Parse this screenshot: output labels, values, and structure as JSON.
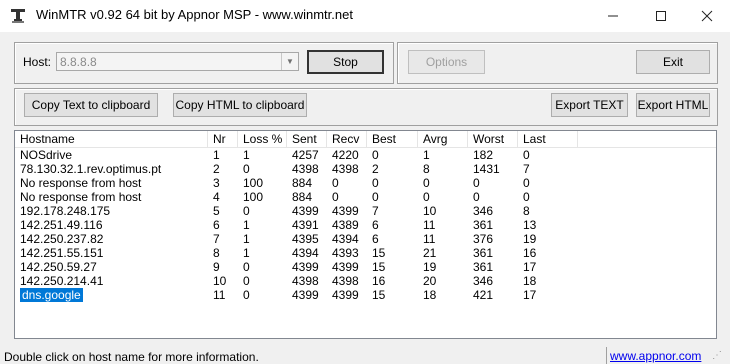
{
  "window": {
    "title": "WinMTR v0.92 64 bit by Appnor MSP - www.winmtr.net"
  },
  "controls": {
    "host_label": "Host:",
    "host_value": "8.8.8.8",
    "stop_label": "Stop",
    "options_label": "Options",
    "exit_label": "Exit",
    "copy_text_label": "Copy Text to clipboard",
    "copy_html_label": "Copy HTML to clipboard",
    "export_text_label": "Export TEXT",
    "export_html_label": "Export HTML"
  },
  "table": {
    "columns": [
      "Hostname",
      "Nr",
      "Loss %",
      "Sent",
      "Recv",
      "Best",
      "Avrg",
      "Worst",
      "Last"
    ],
    "rows": [
      [
        "NOSdrive",
        "1",
        "1",
        "4257",
        "4220",
        "0",
        "1",
        "182",
        "0"
      ],
      [
        "78.130.32.1.rev.optimus.pt",
        "2",
        "0",
        "4398",
        "4398",
        "2",
        "8",
        "1431",
        "7"
      ],
      [
        "No response from host",
        "3",
        "100",
        "884",
        "0",
        "0",
        "0",
        "0",
        "0"
      ],
      [
        "No response from host",
        "4",
        "100",
        "884",
        "0",
        "0",
        "0",
        "0",
        "0"
      ],
      [
        "192.178.248.175",
        "5",
        "0",
        "4399",
        "4399",
        "7",
        "10",
        "346",
        "8"
      ],
      [
        "142.251.49.116",
        "6",
        "1",
        "4391",
        "4389",
        "6",
        "11",
        "361",
        "13"
      ],
      [
        "142.250.237.82",
        "7",
        "1",
        "4395",
        "4394",
        "6",
        "11",
        "376",
        "19"
      ],
      [
        "142.251.55.151",
        "8",
        "1",
        "4394",
        "4393",
        "15",
        "21",
        "361",
        "16"
      ],
      [
        "142.250.59.27",
        "9",
        "0",
        "4399",
        "4399",
        "15",
        "19",
        "361",
        "17"
      ],
      [
        "142.250.214.41",
        "10",
        "0",
        "4398",
        "4398",
        "16",
        "20",
        "346",
        "18"
      ],
      [
        "dns.google",
        "11",
        "0",
        "4399",
        "4399",
        "15",
        "18",
        "421",
        "17"
      ]
    ],
    "selected_row": 10
  },
  "status": {
    "text": "Double click on host name for more information.",
    "link": "www.appnor.com"
  },
  "icons": {
    "app": "winmtr-app-icon",
    "minimize": "minimize-icon",
    "maximize": "maximize-icon",
    "close": "close-icon",
    "dropdown": "chevron-down-icon"
  }
}
